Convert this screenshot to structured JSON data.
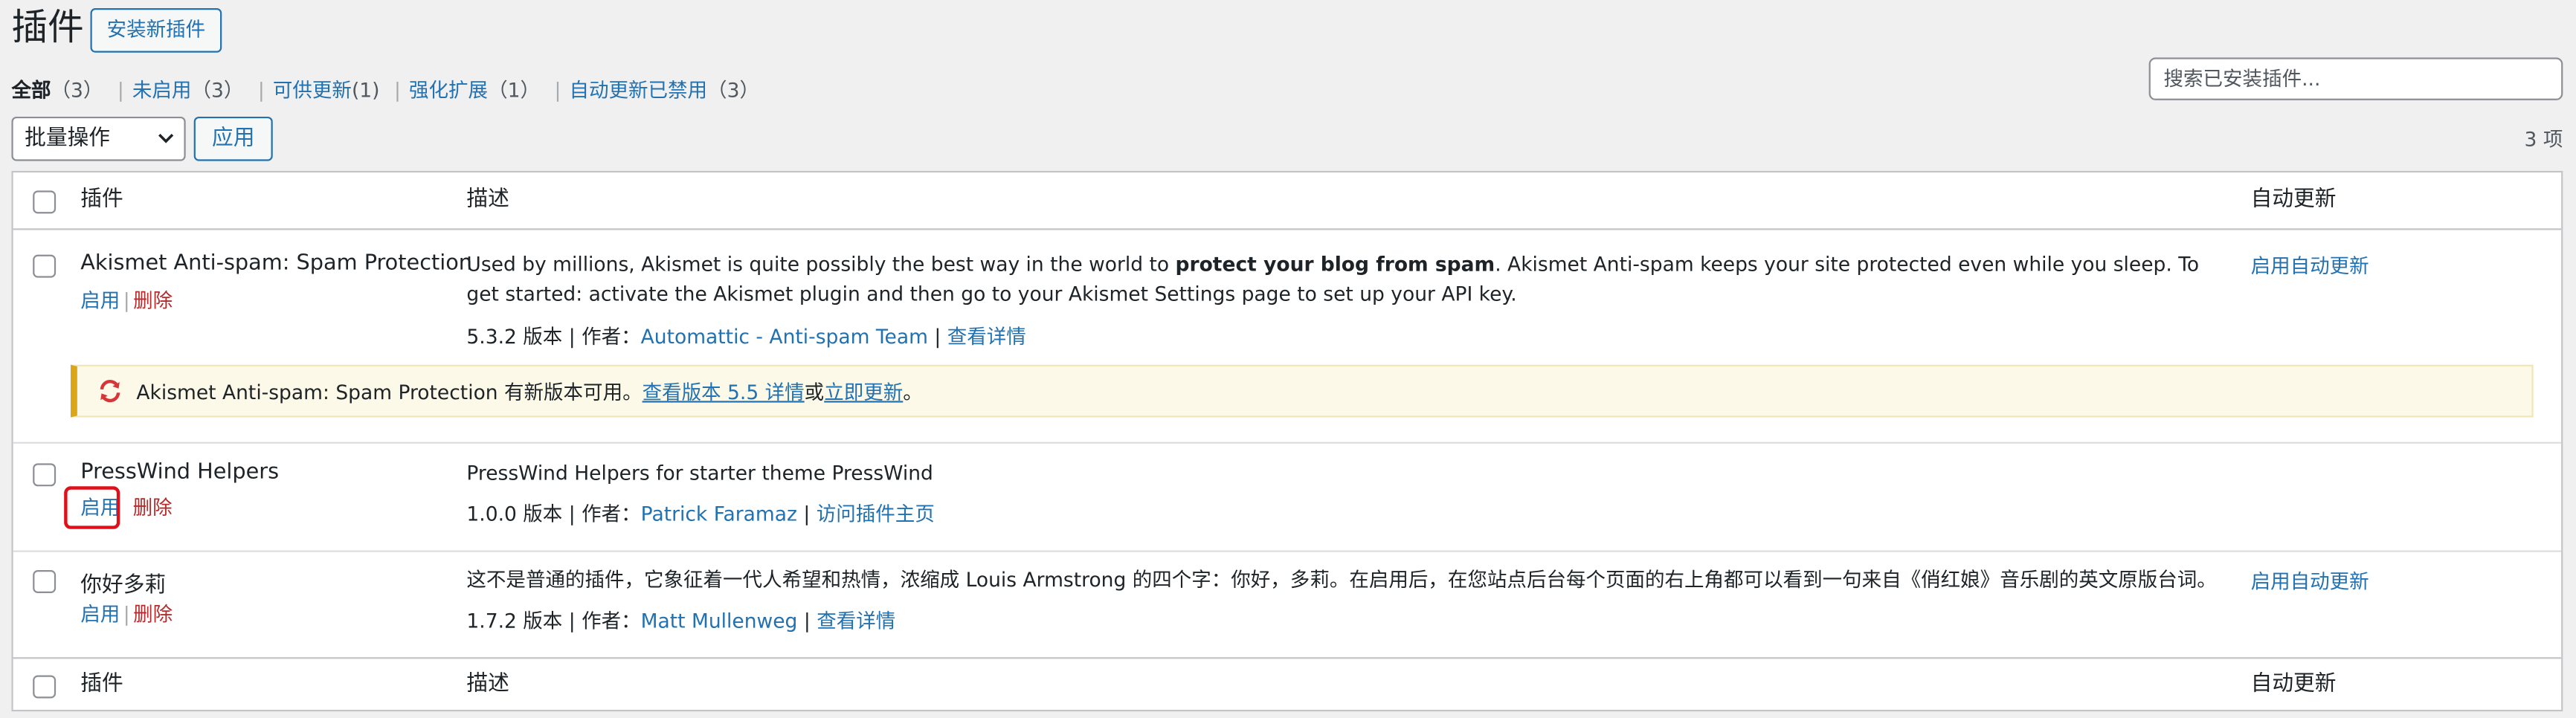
{
  "header": {
    "title": "插件",
    "add_new_label": "安装新插件"
  },
  "filters": {
    "all_label": "全部",
    "all_count": "（3）",
    "inactive_label": "未启用",
    "inactive_count": "（3）",
    "updates_label": "可供更新",
    "updates_count": "(1)",
    "enhance_label": "强化扩展",
    "enhance_count": "（1）",
    "autoupdate_label": "自动更新已禁用",
    "autoupdate_count": "（3）",
    "separator": "|"
  },
  "search": {
    "placeholder": "搜索已安装插件..."
  },
  "bulk": {
    "selected": "批量操作",
    "apply_label": "应用",
    "items_count": "3 项"
  },
  "table": {
    "columns": {
      "plugin": "插件",
      "description": "描述",
      "auto_update": "自动更新"
    },
    "rows": [
      {
        "name": "Akismet Anti-spam: Spam Protection",
        "activate": "启用",
        "delete": "删除",
        "desc_pre": "Used by millions, Akismet is quite possibly the best way in the world to ",
        "desc_bold": "protect your blog from spam",
        "desc_post": ". Akismet Anti-spam keeps your site protected even while you sleep. To get started: activate the Akismet plugin and then go to your Akismet Settings page to set up your API key.",
        "version_text": "5.3.2 版本 | 作者：",
        "author": "Automattic - Anti-spam Team",
        "sep": "|",
        "details_link": "查看详情",
        "auto_update": "启用自动更新"
      },
      {
        "name": "PressWind Helpers",
        "activate": "启用",
        "delete": "删除",
        "desc": "PressWind Helpers for starter theme PressWind",
        "version_text": "1.0.0 版本 | 作者：",
        "author": "Patrick Faramaz",
        "sep": "|",
        "details_link": "访问插件主页"
      },
      {
        "name": "你好多莉",
        "activate": "启用",
        "delete": "删除",
        "desc": "这不是普通的插件，它象征着一代人希望和热情，浓缩成 Louis Armstrong 的四个字：你好，多莉。在启用后，在您站点后台每个页面的右上角都可以看到一句来自《俏红娘》音乐剧的英文原版台词。",
        "version_text": "1.7.2 版本 | 作者：",
        "author": "Matt Mullenweg",
        "sep": "|",
        "details_link": "查看详情",
        "auto_update": "启用自动更新"
      }
    ]
  },
  "notice": {
    "text": "Akismet Anti-spam: Spam Protection 有新版本可用。",
    "view_link": "查看版本 5.5 详情",
    "or": "或",
    "update_link": "立即更新",
    "end": "。"
  },
  "colors": {
    "link": "#2271b1",
    "delete": "#b32d2e",
    "notice_border": "#dba617",
    "highlight": "#e0101a"
  }
}
